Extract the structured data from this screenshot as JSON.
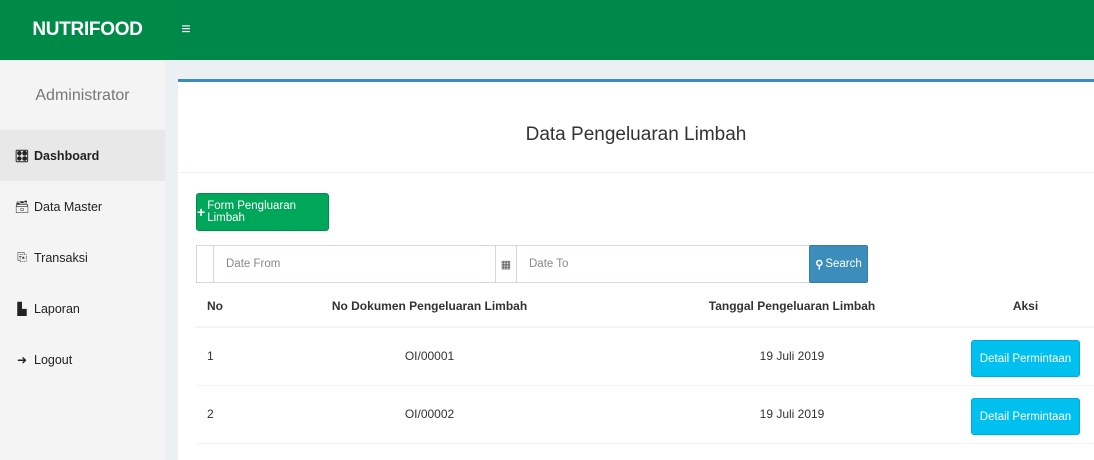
{
  "header": {
    "brand": "NUTRIFOOD",
    "toggle_icon": "hamburger-icon",
    "toggle_symbol": "≡"
  },
  "sidebar": {
    "user": "Administrator",
    "items": [
      {
        "label": "Dashboard",
        "icon": "dashboard-icon",
        "symbol": "🎛"
      },
      {
        "label": "Data Master",
        "icon": "archive-icon",
        "symbol": "🗃"
      },
      {
        "label": "Transaksi",
        "icon": "copy-icon",
        "symbol": "⎘"
      },
      {
        "label": "Laporan",
        "icon": "file-icon",
        "symbol": "▙"
      },
      {
        "label": "Logout",
        "icon": "sign-out-icon",
        "symbol": "➜"
      }
    ]
  },
  "main": {
    "title": "Data Pengeluaran Limbah",
    "add_button": "Form Pengluaran Limbah",
    "date_from_placeholder": "Date From",
    "date_to_placeholder": "Date To",
    "search_button": "Search",
    "columns": {
      "no": "No",
      "doc": "No Dokumen Pengeluaran Limbah",
      "date": "Tanggal Pengeluaran Limbah",
      "action": "Aksi"
    },
    "rows": [
      {
        "no": "1",
        "doc": "OI/00001",
        "date": "19 Juli 2019",
        "action": "Detail Permintaan"
      },
      {
        "no": "2",
        "doc": "OI/00002",
        "date": "19 Juli 2019",
        "action": "Detail Permintaan"
      }
    ]
  },
  "colors": {
    "header_green": "#00874a",
    "add_button": "#00a65a",
    "search_button": "#3c8dbc",
    "detail_button": "#00c0ef",
    "box_accent": "#3c8dbc"
  }
}
